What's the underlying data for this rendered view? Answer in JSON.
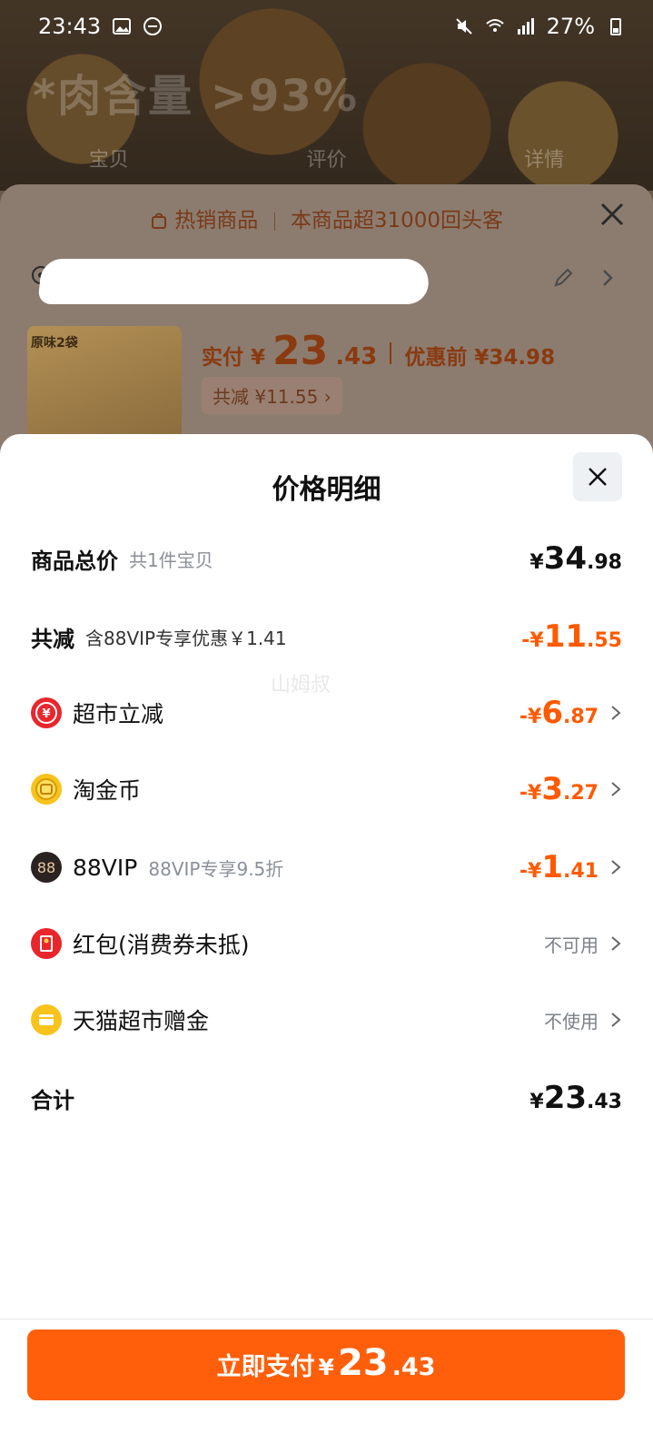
{
  "status_bar": {
    "time": "23:43",
    "battery": "27%"
  },
  "background_page": {
    "hero_text": "*肉含量 >93%",
    "tabs": [
      "宝贝",
      "评价",
      "详情"
    ]
  },
  "order_sheet": {
    "banner_label": "热销商品",
    "banner_text": "本商品超31000回头客",
    "thumb_tag": "原味2袋",
    "paid_label": "实付",
    "paid_currency": "¥",
    "paid_int": "23",
    "paid_dec": ".43",
    "before_label": "优惠前",
    "before_amount": "¥34.98",
    "saving_label": "共减",
    "saving_amount": "¥11.55"
  },
  "price_detail": {
    "title": "价格明细",
    "watermark": "山姆叔",
    "total": {
      "label": "商品总价",
      "sub": "共1件宝贝",
      "cur": "¥",
      "int": "34",
      "dec": ".98"
    },
    "discount": {
      "label": "共减",
      "sub": "含88VIP专享优惠￥1.41",
      "cur": "-¥",
      "int": "11",
      "dec": ".55"
    },
    "items": [
      {
        "name": "超市立减",
        "sub": "",
        "cur": "-¥",
        "int": "6",
        "dec": ".87",
        "icon": "yuan-coin-icon",
        "color": "#e8262c"
      },
      {
        "name": "淘金币",
        "sub": "",
        "cur": "-¥",
        "int": "3",
        "dec": ".27",
        "icon": "gold-coin-icon",
        "color": "#f7c31c"
      },
      {
        "name": "88VIP",
        "sub": "88VIP专享9.5折",
        "cur": "-¥",
        "int": "1",
        "dec": ".41",
        "icon": "vip-88-icon",
        "color": "#2a2321"
      }
    ],
    "red_packet": {
      "name": "红包(消费券未抵)",
      "status": "不可用"
    },
    "gift_money": {
      "name": "天猫超市赠金",
      "status": "不使用"
    },
    "sum": {
      "label": "合计",
      "cur": "¥",
      "int": "23",
      "dec": ".43"
    }
  },
  "pay_button": {
    "label": "立即支付",
    "cur": "¥",
    "int": "23",
    "dec": ".43"
  },
  "colors": {
    "accent": "#ff5a00",
    "button": "#ff5f0a"
  }
}
